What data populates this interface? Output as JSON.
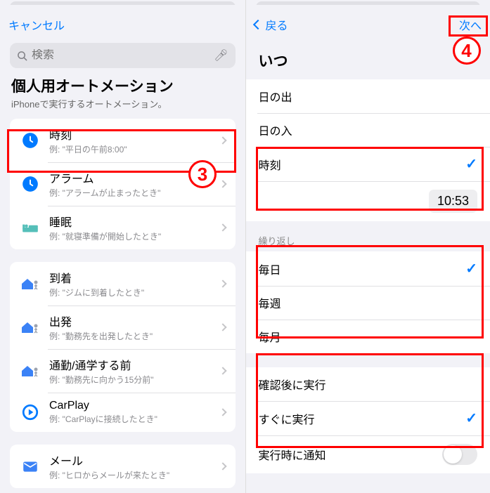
{
  "left": {
    "cancel": "キャンセル",
    "search_placeholder": "検索",
    "title": "個人用オートメーション",
    "subtitle": "iPhoneで実行するオートメーション。",
    "group1": [
      {
        "name": "時刻",
        "sub": "例: \"平日の午前8:00\""
      },
      {
        "name": "アラーム",
        "sub": "例: \"アラームが止まったとき\""
      },
      {
        "name": "睡眠",
        "sub": "例: \"就寝準備が開始したとき\""
      }
    ],
    "group2": [
      {
        "name": "到着",
        "sub": "例: \"ジムに到着したとき\""
      },
      {
        "name": "出発",
        "sub": "例: \"勤務先を出発したとき\""
      },
      {
        "name": "通勤/通学する前",
        "sub": "例: \"勤務先に向かう15分前\""
      },
      {
        "name": "CarPlay",
        "sub": "例: \"CarPlayに接続したとき\""
      }
    ],
    "group3": [
      {
        "name": "メール",
        "sub": "例: \"ヒロからメールが来たとき\""
      }
    ]
  },
  "right": {
    "back": "戻る",
    "next": "次へ",
    "when": "いつ",
    "opts": [
      "日の出",
      "日の入",
      "時刻"
    ],
    "time": "10:53",
    "repeat_label": "繰り返し",
    "repeat": [
      "毎日",
      "毎週",
      "毎月"
    ],
    "exec": [
      "確認後に実行",
      "すぐに実行"
    ],
    "notify": "実行時に通知"
  },
  "anno": {
    "n3": "3",
    "n4": "4"
  }
}
